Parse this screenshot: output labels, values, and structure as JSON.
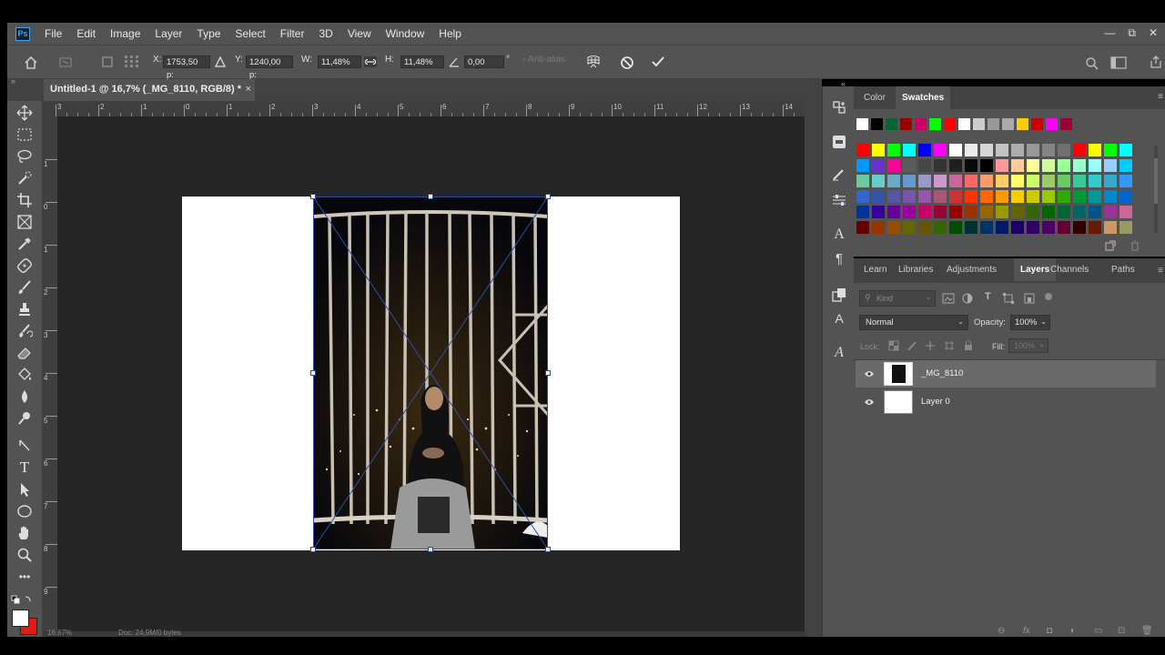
{
  "app": {
    "logo": "Ps"
  },
  "menu": [
    "File",
    "Edit",
    "Image",
    "Layer",
    "Type",
    "Select",
    "Filter",
    "3D",
    "View",
    "Window",
    "Help"
  ],
  "window_controls": {
    "minimize": "—",
    "restore": "⧉",
    "close": "✕"
  },
  "options": {
    "x_label": "X:",
    "x_value": "1753,50 p:",
    "y_label": "Y:",
    "y_value": "1240,00 p:",
    "w_label": "W:",
    "w_value": "11,48%",
    "h_label": "H:",
    "h_value": "11,48%",
    "angle_value": "0,00",
    "angle_unit": "°",
    "anti_alias": "Anti-alias"
  },
  "document": {
    "tab_title": "Untitled-1 @ 16,7% (_MG_8110, RGB/8) *",
    "close": "×"
  },
  "ruler_top": [
    "3",
    "2",
    "1",
    "0",
    "1",
    "2",
    "3",
    "4",
    "5",
    "6",
    "7",
    "8",
    "9",
    "10",
    "11",
    "12",
    "13",
    "14"
  ],
  "ruler_left": [
    "1",
    "0",
    "1",
    "2",
    "3",
    "4",
    "5",
    "6",
    "7",
    "8",
    "9"
  ],
  "status": {
    "zoom": "16,67%",
    "doc": "Doc: 24,9M/0 bytes"
  },
  "color_panel": {
    "tabs": [
      "Color",
      "Swatches"
    ],
    "active": "Swatches"
  },
  "swatch_colors": {
    "row0": [
      "#ffffff",
      "#000000",
      "#006633",
      "#990000",
      "#cc0066",
      "#00ff00",
      "#ff0000",
      "#ffffff",
      "#cccccc",
      "#999999",
      "#aaaaaa",
      "#ffcc00",
      "#cc0000",
      "#ff00ff",
      "#990033"
    ],
    "row1": [
      "#ff0000",
      "#ffff00",
      "#00ff00",
      "#00ffff",
      "#0000ff",
      "#ff00ff",
      "#ffffff",
      "#ebebeb",
      "#d6d6d6",
      "#c2c2c2",
      "#adadad",
      "#999999",
      "#858585",
      "#707070",
      "#ff0000",
      "#ffff00",
      "#00ff00",
      "#00ffff"
    ],
    "row2": [
      "#0099ff",
      "#6633cc",
      "#ff0099",
      "#5c5c5c",
      "#474747",
      "#333333",
      "#1f1f1f",
      "#0a0a0a",
      "#000000",
      "#ff9999",
      "#ffcc99",
      "#ffff99",
      "#ccff99",
      "#99ff99",
      "#99ffcc",
      "#99ffff",
      "#99ccff",
      "#00ccff"
    ],
    "row3": [
      "#66cc99",
      "#66cccc",
      "#66aacc",
      "#6699cc",
      "#9999cc",
      "#cc99cc",
      "#cc6699",
      "#ff6666",
      "#ff9966",
      "#ffcc66",
      "#ffff66",
      "#ccff66",
      "#99cc66",
      "#66cc66",
      "#33cc99",
      "#33cccc",
      "#33aacc",
      "#3399ff"
    ],
    "row4": [
      "#3366cc",
      "#3355aa",
      "#5555aa",
      "#7755aa",
      "#9955aa",
      "#aa5577",
      "#cc3333",
      "#ff3300",
      "#ff6600",
      "#ff9900",
      "#ffcc00",
      "#cccc00",
      "#99cc00",
      "#33aa00",
      "#009933",
      "#009999",
      "#0088cc",
      "#0066cc"
    ],
    "row5": [
      "#003399",
      "#330099",
      "#660099",
      "#990099",
      "#cc0066",
      "#990033",
      "#990000",
      "#993300",
      "#996600",
      "#999900",
      "#666600",
      "#336600",
      "#006600",
      "#006633",
      "#006666",
      "#005588",
      "#993399",
      "#cc6699"
    ],
    "row6": [
      "#660000",
      "#993300",
      "#994d00",
      "#666600",
      "#665500",
      "#336600",
      "#004d00",
      "#003333",
      "#003366",
      "#001a66",
      "#1a0066",
      "#330066",
      "#4d0066",
      "#660033",
      "#330000",
      "#661a00",
      "#cc9966",
      "#999966"
    ]
  },
  "layers_panel": {
    "tabs": [
      "Learn",
      "Libraries",
      "Adjustments",
      "Layers",
      "Channels",
      "Paths"
    ],
    "active": "Layers",
    "filter_placeholder": "Kind",
    "blend_mode": "Normal",
    "opacity_label": "Opacity:",
    "opacity_value": "100%",
    "lock_label": "Lock:",
    "fill_label": "Fill:",
    "fill_value": "100%",
    "layers": [
      {
        "name": "_MG_8110",
        "selected": true
      },
      {
        "name": "Layer 0",
        "selected": false
      }
    ]
  }
}
